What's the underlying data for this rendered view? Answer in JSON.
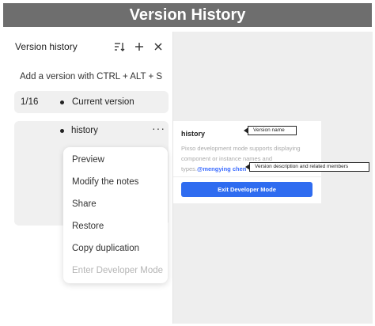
{
  "banner": {
    "title": "Version History"
  },
  "panel": {
    "title": "Version history",
    "sort_icon": "sort-icon",
    "add_icon": "plus-icon",
    "close_icon": "close-icon",
    "hint": "Add a version with CTRL + ALT + S"
  },
  "versions": {
    "counter": "1/16",
    "current_label": "Current version",
    "history_label": "history",
    "more_icon": "more-horizontal-icon"
  },
  "menu": {
    "items": [
      {
        "label": "Preview",
        "enabled": true
      },
      {
        "label": "Modify the notes",
        "enabled": true
      },
      {
        "label": "Share",
        "enabled": true
      },
      {
        "label": "Restore",
        "enabled": true
      },
      {
        "label": "Copy duplication",
        "enabled": true
      },
      {
        "label": "Enter Developer Mode",
        "enabled": false
      }
    ]
  },
  "card": {
    "title": "history",
    "description": "Pixso development mode supports displaying component or instance names and types.",
    "member": "@mengying chen",
    "exit_button": "Exit Developer Mode"
  },
  "callouts": {
    "version_name": "Version name",
    "description": "Version description and related members"
  },
  "colors": {
    "accent": "#2f6cf0",
    "banner": "#6e6e6e",
    "member": "#3b6cff"
  }
}
